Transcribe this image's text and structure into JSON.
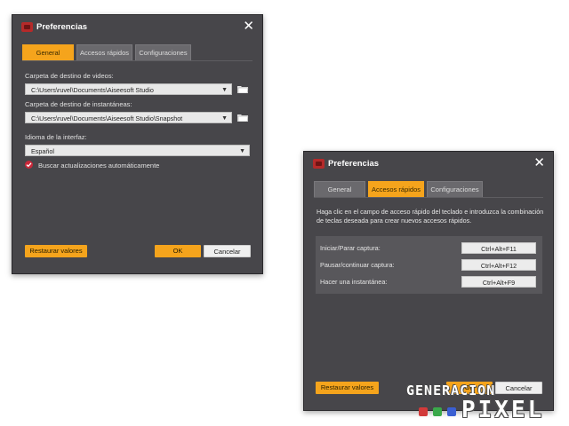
{
  "dialog_general": {
    "title": "Preferencias",
    "tabs": [
      {
        "label": "General",
        "active": true
      },
      {
        "label": "Accesos rápidos",
        "active": false
      },
      {
        "label": "Configuraciones",
        "active": false
      }
    ],
    "video_dest_label": "Carpeta de destino de videos:",
    "video_dest_value": "C:\\Users\\ruvel\\Documents\\Aiseesoft Studio",
    "snapshot_dest_label": "Carpeta de destino de instantáneas:",
    "snapshot_dest_value": "C:\\Users\\ruvel\\Documents\\Aiseesoft Studio\\Snapshot",
    "language_label": "Idioma de la interfaz:",
    "language_value": "Español",
    "auto_update_label": "Buscar actualizaciones automáticamente",
    "auto_update_checked": true,
    "restore_label": "Restaurar valores",
    "ok_label": "OK",
    "cancel_label": "Cancelar"
  },
  "dialog_hotkeys": {
    "title": "Preferencias",
    "tabs": [
      {
        "label": "General",
        "active": false
      },
      {
        "label": "Accesos rápidos",
        "active": true
      },
      {
        "label": "Configuraciones",
        "active": false
      }
    ],
    "description": "Haga clic en el campo de acceso rápido del teclado e introduzca la combinación de teclas deseada para crear nuevos accesos rápidos.",
    "hotkeys": [
      {
        "label": "Iniciar/Parar captura:",
        "value": "Ctrl+Alt+F11"
      },
      {
        "label": "Pausar/continuar captura:",
        "value": "Ctrl+Alt+F12"
      },
      {
        "label": "Hacer una instantánea:",
        "value": "Ctrl+Alt+F9"
      }
    ],
    "restore_label": "Restaurar valores",
    "ok_label": "OK",
    "cancel_label": "Cancelar"
  },
  "watermark": {
    "line1": "GENERACION",
    "line2": "PIXEL",
    "dot_colors": [
      "#d23a3a",
      "#3aa84a",
      "#3a5fd2"
    ]
  },
  "colors": {
    "accent": "#f5a41c",
    "dialog_bg": "#47464a",
    "checkbox": "#c9283a"
  }
}
